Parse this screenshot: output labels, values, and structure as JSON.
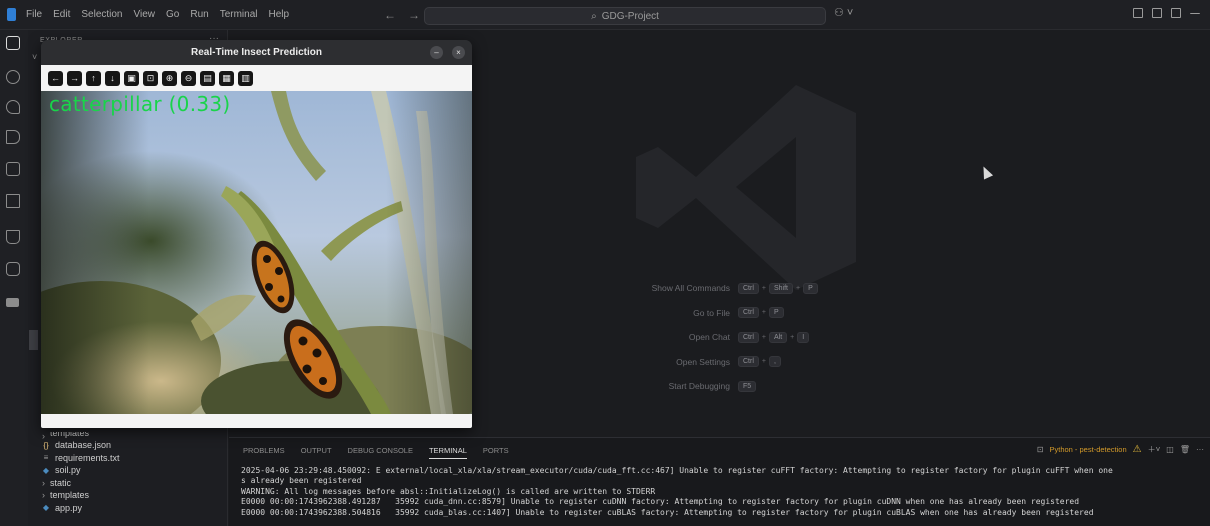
{
  "titlebar": {
    "menus": [
      "File",
      "Edit",
      "Selection",
      "View",
      "Go",
      "Run",
      "Terminal",
      "Help"
    ],
    "search_text": "GDG-Project",
    "back_icon": "arrow-left-icon",
    "forward_icon": "arrow-right-icon"
  },
  "explorer": {
    "header": "EXPLORER",
    "files": [
      {
        "name": "templates",
        "type": "folder-partial",
        "icon": "chevron-right-icon"
      },
      {
        "name": "database.json",
        "type": "file",
        "icon": "json-braces-icon",
        "icon_text": "{}",
        "color": "#e5c07b"
      },
      {
        "name": "requirements.txt",
        "type": "file",
        "icon": "lines-icon",
        "icon_text": "≡",
        "color": "#9a9a9a"
      },
      {
        "name": "soil.py",
        "type": "file",
        "icon": "python-icon",
        "icon_text": "◆",
        "color": "#4b8bbe"
      },
      {
        "name": "static",
        "type": "folder",
        "icon": "chevron-right-icon"
      },
      {
        "name": "templates",
        "type": "folder",
        "icon": "chevron-right-icon"
      },
      {
        "name": "app.py",
        "type": "file",
        "icon": "python-icon",
        "icon_text": "◆",
        "color": "#4b8bbe"
      }
    ]
  },
  "welcome": {
    "shortcuts": [
      {
        "label": "Show All Commands",
        "keys": [
          "Ctrl",
          "Shift",
          "P"
        ]
      },
      {
        "label": "Go to File",
        "keys": [
          "Ctrl",
          "P"
        ]
      },
      {
        "label": "Open Chat",
        "keys": [
          "Ctrl",
          "Alt",
          "I"
        ]
      },
      {
        "label": "Open Settings",
        "keys": [
          "Ctrl",
          ","
        ]
      },
      {
        "label": "Start Debugging",
        "keys": [
          "F5"
        ]
      }
    ]
  },
  "panel": {
    "tabs": [
      "PROBLEMS",
      "OUTPUT",
      "DEBUG CONSOLE",
      "TERMINAL",
      "PORTS"
    ],
    "active_tab": "TERMINAL",
    "terminal_name": "Python - pest-detection",
    "terminal_lines": [
      "2025-04-06 23:29:48.450092: E external/local_xla/xla/stream_executor/cuda/cuda_fft.cc:467] Unable to register cuFFT factory: Attempting to register factory for plugin cuFFT when one",
      "s already been registered",
      "WARNING: All log messages before absl::InitializeLog() is called are written to STDERR",
      "E0000 00:00:1743962388.491287   35992 cuda_dnn.cc:8579] Unable to register cuDNN factory: Attempting to register factory for plugin cuDNN when one has already been registered",
      "E0000 00:00:1743962388.504816   35992 cuda_blas.cc:1407] Unable to register cuBLAS factory: Attempting to register factory for plugin cuBLAS when one has already been registered"
    ]
  },
  "cv_window": {
    "title": "Real-Time Insect Prediction",
    "minimize_glyph": "–",
    "close_glyph": "×",
    "prediction": "catterpillar (0.33)",
    "prediction_color": "#19d44a",
    "toolbar": [
      {
        "name": "pan-left-icon",
        "glyph": "←"
      },
      {
        "name": "pan-right-icon",
        "glyph": "→"
      },
      {
        "name": "pan-up-icon",
        "glyph": "↑"
      },
      {
        "name": "pan-down-icon",
        "glyph": "↓"
      },
      {
        "name": "zoom-fit-icon",
        "glyph": "▣"
      },
      {
        "name": "zoom-original-icon",
        "glyph": "⊡"
      },
      {
        "name": "zoom-in-icon",
        "glyph": "⊕"
      },
      {
        "name": "zoom-out-icon",
        "glyph": "⊖"
      },
      {
        "name": "save-image-icon",
        "glyph": "▤"
      },
      {
        "name": "properties-icon",
        "glyph": "▦"
      },
      {
        "name": "expanded-gui-icon",
        "glyph": "▥"
      }
    ]
  },
  "colors": {
    "accent": "#2f7fd6",
    "terminal_warning": "#e2b93b"
  }
}
